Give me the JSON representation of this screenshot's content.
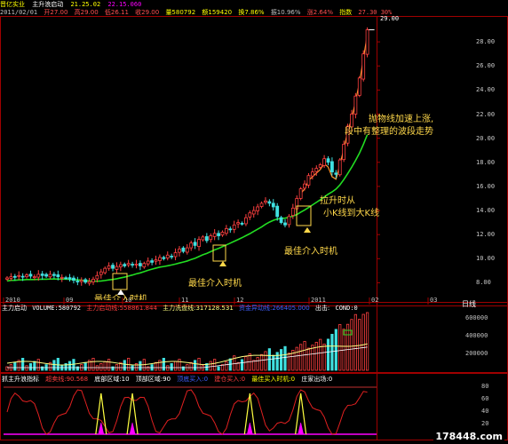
{
  "header": {
    "line1": {
      "stock_name": "晋亿实业",
      "indicator_name": "主升浪启动",
      "v1": "21.25.02",
      "v2": "22.15.060"
    },
    "line2": {
      "date": "2011/02/01",
      "open": "开27.00",
      "high": "高29.00",
      "low": "低26.11",
      "close": "收29.00",
      "volume": "量580792",
      "amount": "额159420",
      "turnover": "换7.86%",
      "amplitude": "振10.96%",
      "change": "涨2.64%",
      "index": "指数",
      "extra": "27.30 30%"
    }
  },
  "price_axis": {
    "labels": [
      "28.00",
      "26.00",
      "24.00",
      "22.00",
      "20.00",
      "18.00",
      "16.00",
      "14.00",
      "12.00",
      "10.00",
      "8.00"
    ],
    "high_marker": "29.00"
  },
  "time_axis": {
    "labels": [
      "2010",
      "09",
      "10",
      "11",
      "12",
      "2011",
      "02",
      "03"
    ]
  },
  "annotations": {
    "a1": "抛物线加速上涨,",
    "a2": "段中有整理的波段走势",
    "a3": "拉升时从",
    "a4": "小K线到大K线",
    "a5": "最佳介入时机",
    "a6": "最佳介入时机",
    "a7": "最佳介入时机"
  },
  "volume_panel": {
    "name": "主力启动",
    "volume_label": "VOLUME:580792",
    "ind1": "主力启动线:558861.844",
    "ind2": "主力洗盘线:317128.531",
    "ind3": "资金异动线:266405.000",
    "ind4": "出击:",
    "ind5": "COND:0",
    "right_title": "日线",
    "axis": [
      "600000",
      "400000",
      "200000"
    ]
  },
  "bottom_panel": {
    "name": "抓主升浪指标",
    "ind1": "超卖线:90.568",
    "ind2": "底部区域:10",
    "ind3": "顶部区域:90",
    "ind4": "顶底买入:0",
    "ind5": "建仓买入:0",
    "ind6": "最佳买入时机:0",
    "ind7": "庄家出场:0",
    "axis": [
      "80",
      "60",
      "40",
      "20"
    ]
  },
  "watermark": "178448.com",
  "chart_data": {
    "type": "candlestick",
    "title": "晋亿实业",
    "ylim": [
      7,
      30
    ],
    "ma_line_color": "#22dd22",
    "up_color": "#ff4040",
    "down_color": "#40e0e0",
    "closes": [
      8.4,
      8.5,
      8.45,
      8.6,
      8.5,
      8.65,
      8.55,
      8.5,
      8.7,
      8.6,
      8.55,
      8.7,
      8.6,
      8.5,
      8.45,
      8.4,
      8.3,
      8.2,
      8.1,
      8.2,
      8.05,
      8.1,
      8.3,
      8.6,
      8.9,
      9.2,
      9.4,
      9.2,
      9.35,
      9.5,
      9.4,
      9.6,
      9.5,
      9.55,
      9.4,
      9.6,
      9.8,
      9.7,
      9.9,
      10.1,
      10.0,
      10.3,
      10.2,
      10.5,
      10.8,
      10.6,
      10.9,
      11.3,
      11.1,
      11.6,
      11.8,
      11.5,
      11.9,
      12.1,
      11.9,
      12.2,
      12.5,
      12.4,
      12.8,
      13.0,
      12.9,
      13.4,
      13.8,
      14.0,
      14.3,
      14.6,
      14.8,
      14.6,
      14.3,
      13.5,
      13.0,
      12.8,
      13.5,
      14.2,
      15.0,
      15.8,
      16.2,
      16.9,
      17.2,
      17.5,
      17.8,
      18.3,
      18.0,
      17.2,
      17.0,
      18.2,
      19.5,
      21.0,
      22.0,
      23.5,
      25.0,
      27.0,
      29.0
    ]
  }
}
